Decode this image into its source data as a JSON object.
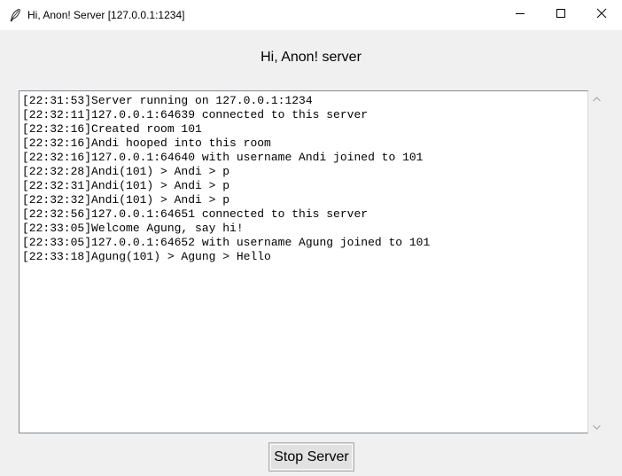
{
  "window": {
    "title": "Hi, Anon! Server [127.0.0.1:1234]",
    "icon": "feather-icon",
    "controls": {
      "minimize_icon": "minimize-icon",
      "maximize_icon": "maximize-icon",
      "close_icon": "close-icon"
    }
  },
  "header": {
    "label": "Hi, Anon! server"
  },
  "log": {
    "lines": [
      "[22:31:53]Server running on 127.0.0.1:1234",
      "[22:32:11]127.0.0.1:64639 connected to this server",
      "[22:32:16]Created room 101",
      "[22:32:16]Andi hooped into this room",
      "[22:32:16]127.0.0.1:64640 with username Andi joined to 101",
      "[22:32:28]Andi(101) > Andi > p",
      "[22:32:31]Andi(101) > Andi > p",
      "[22:32:32]Andi(101) > Andi > p",
      "[22:32:56]127.0.0.1:64651 connected to this server",
      "[22:33:05]Welcome Agung, say hi!",
      "[22:33:05]127.0.0.1:64652 with username Agung joined to 101",
      "[22:33:18]Agung(101) > Agung > Hello"
    ],
    "scroll_up_icon": "chevron-up-icon",
    "scroll_down_icon": "chevron-down-icon"
  },
  "footer": {
    "stop_label": "Stop Server"
  },
  "colors": {
    "window_bg": "#f0f0f0",
    "titlebar_bg": "#ffffff",
    "text_area_bg": "#ffffff",
    "button_bg": "#e1e1e1",
    "button_border": "#adadad"
  }
}
